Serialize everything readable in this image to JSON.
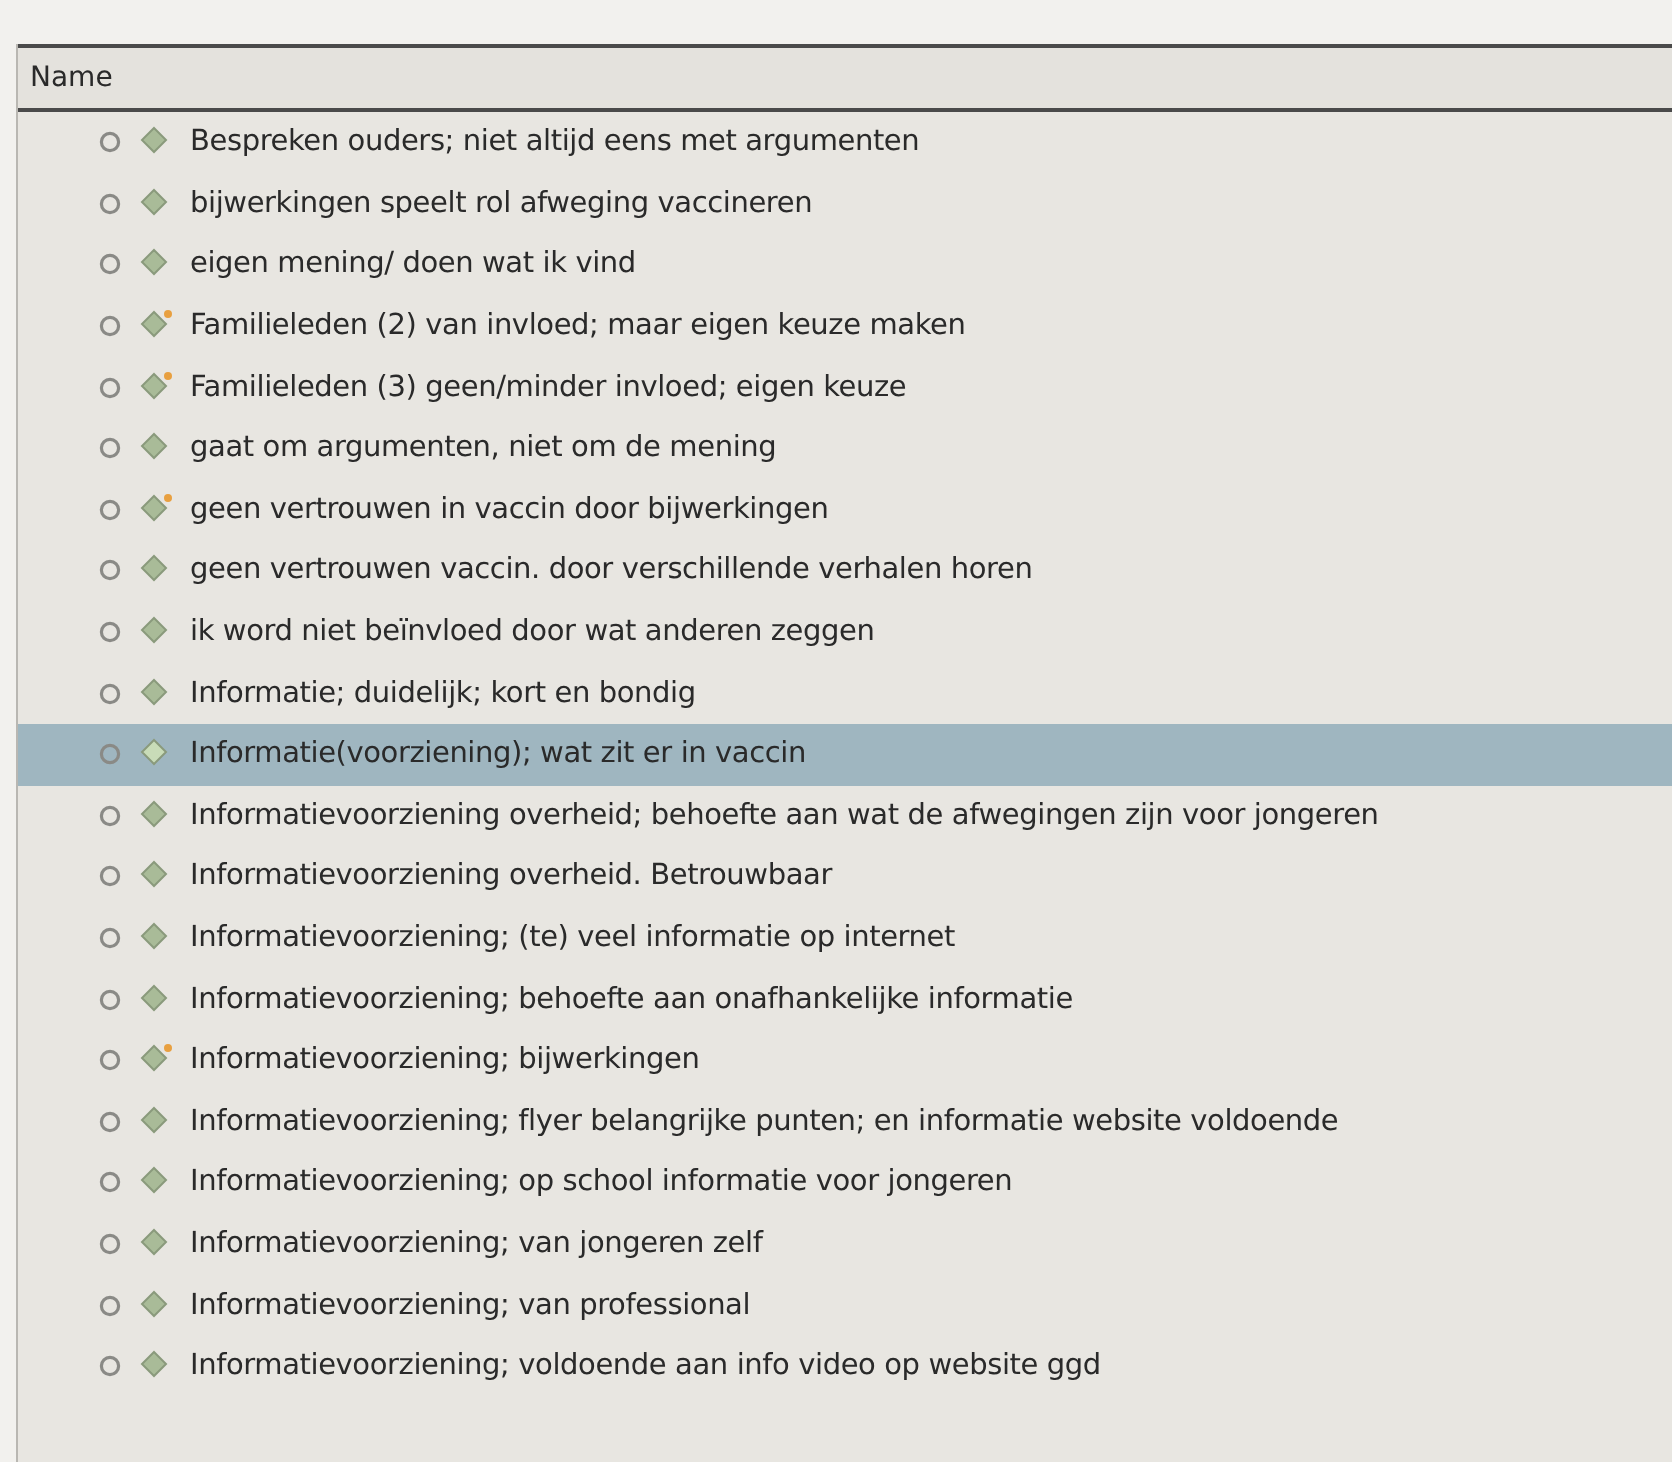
{
  "table": {
    "columns": [
      {
        "label": "Name"
      }
    ],
    "rows": [
      {
        "name": "Bespreken ouders; niet altijd eens met argumenten",
        "has_memo": false,
        "selected": false
      },
      {
        "name": "bijwerkingen speelt rol afweging vaccineren",
        "has_memo": false,
        "selected": false
      },
      {
        "name": "eigen mening/ doen wat ik vind",
        "has_memo": false,
        "selected": false
      },
      {
        "name": "Familieleden (2) van invloed; maar eigen keuze maken",
        "has_memo": true,
        "selected": false
      },
      {
        "name": "Familieleden (3)  geen/minder invloed; eigen keuze",
        "has_memo": true,
        "selected": false
      },
      {
        "name": "gaat om argumenten, niet om de mening",
        "has_memo": false,
        "selected": false
      },
      {
        "name": "geen vertrouwen in vaccin door bijwerkingen",
        "has_memo": true,
        "selected": false
      },
      {
        "name": "geen vertrouwen vaccin. door verschillende verhalen horen",
        "has_memo": false,
        "selected": false
      },
      {
        "name": "ik word niet beïnvloed door wat anderen zeggen",
        "has_memo": false,
        "selected": false
      },
      {
        "name": "Informatie; duidelijk; kort en bondig",
        "has_memo": false,
        "selected": false
      },
      {
        "name": "Informatie(voorziening); wat zit er in vaccin",
        "has_memo": false,
        "selected": true
      },
      {
        "name": "Informatievoorziening overheid; behoefte aan wat de afwegingen zijn voor jongeren",
        "has_memo": false,
        "selected": false
      },
      {
        "name": "Informatievoorziening overheid. Betrouwbaar",
        "has_memo": false,
        "selected": false
      },
      {
        "name": "Informatievoorziening; (te) veel informatie op internet",
        "has_memo": false,
        "selected": false
      },
      {
        "name": "Informatievoorziening; behoefte aan onafhankelijke informatie",
        "has_memo": false,
        "selected": false
      },
      {
        "name": "Informatievoorziening; bijwerkingen",
        "has_memo": true,
        "selected": false
      },
      {
        "name": "Informatievoorziening; flyer belangrijke punten; en informatie website voldoende",
        "has_memo": false,
        "selected": false
      },
      {
        "name": "Informatievoorziening; op school informatie voor jongeren",
        "has_memo": false,
        "selected": false
      },
      {
        "name": "Informatievoorziening; van jongeren zelf",
        "has_memo": false,
        "selected": false
      },
      {
        "name": "Informatievoorziening; van professional",
        "has_memo": false,
        "selected": false
      },
      {
        "name": "Informatievoorziening; voldoende aan info video op website ggd",
        "has_memo": false,
        "selected": false
      }
    ]
  }
}
